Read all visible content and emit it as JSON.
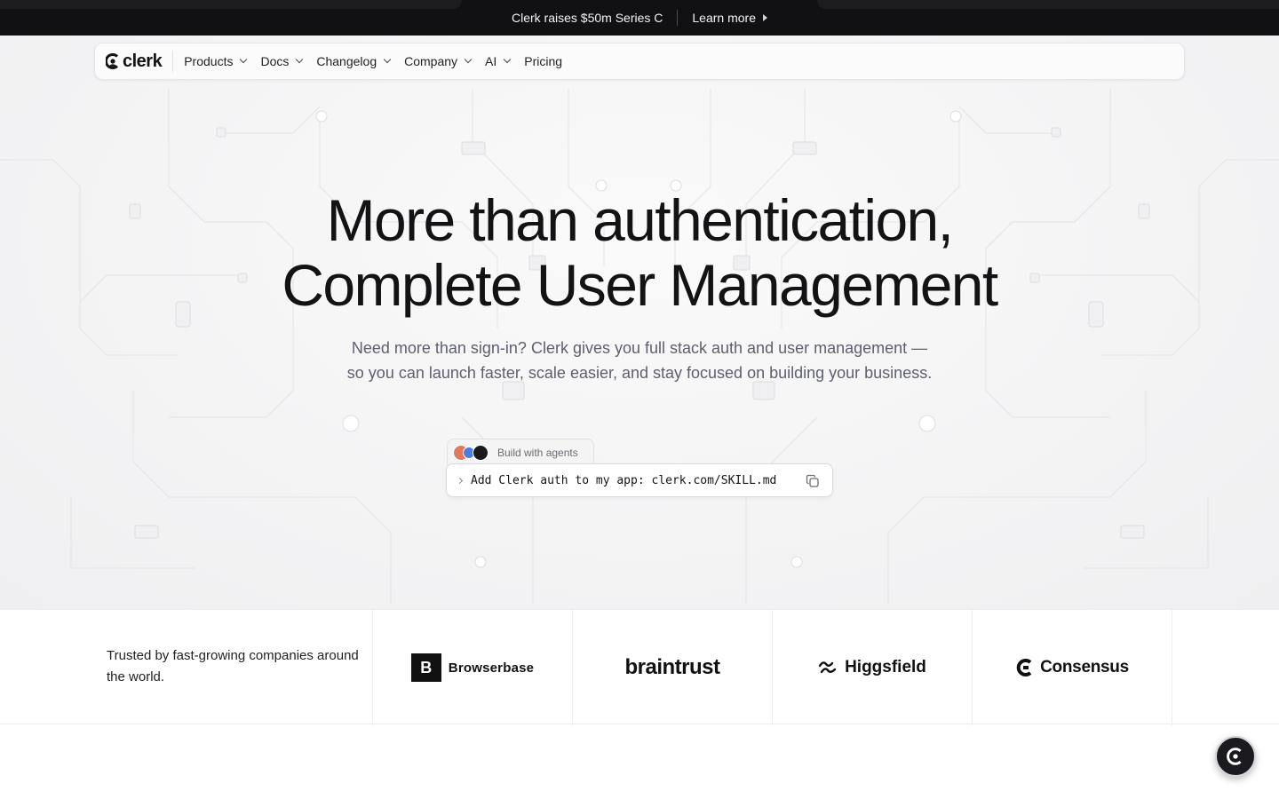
{
  "announcement": {
    "message": "Clerk raises $50m Series C",
    "link_label": "Learn more"
  },
  "nav": {
    "logo_text": "clerk",
    "items": [
      {
        "label": "Products",
        "has_dropdown": true
      },
      {
        "label": "Docs",
        "has_dropdown": true
      },
      {
        "label": "Changelog",
        "has_dropdown": true
      },
      {
        "label": "Company",
        "has_dropdown": true
      },
      {
        "label": "AI",
        "has_dropdown": true
      },
      {
        "label": "Pricing",
        "has_dropdown": false
      }
    ]
  },
  "hero": {
    "headline_line1": "More than authentication,",
    "headline_line2": "Complete User Management",
    "subtitle": "Need more than sign-in? Clerk gives you full stack auth and user management — so you can launch faster, scale easier, and stay focused on building your business.",
    "agent_tab_label": "Build with agents",
    "command": "Add Clerk auth to my app: clerk.com/SKILL.md"
  },
  "trusted": {
    "text": "Trusted by fast-growing companies around the world.",
    "logos": [
      {
        "name": "Browserbase",
        "mark": "B"
      },
      {
        "name": "braintrust"
      },
      {
        "name": "Higgsfield"
      },
      {
        "name": "Consensus"
      }
    ]
  },
  "colors": {
    "announcement_bg": "#111113",
    "text_primary": "#131316",
    "text_secondary": "#5e5f6e",
    "fab_bg": "#1b1b1f"
  }
}
